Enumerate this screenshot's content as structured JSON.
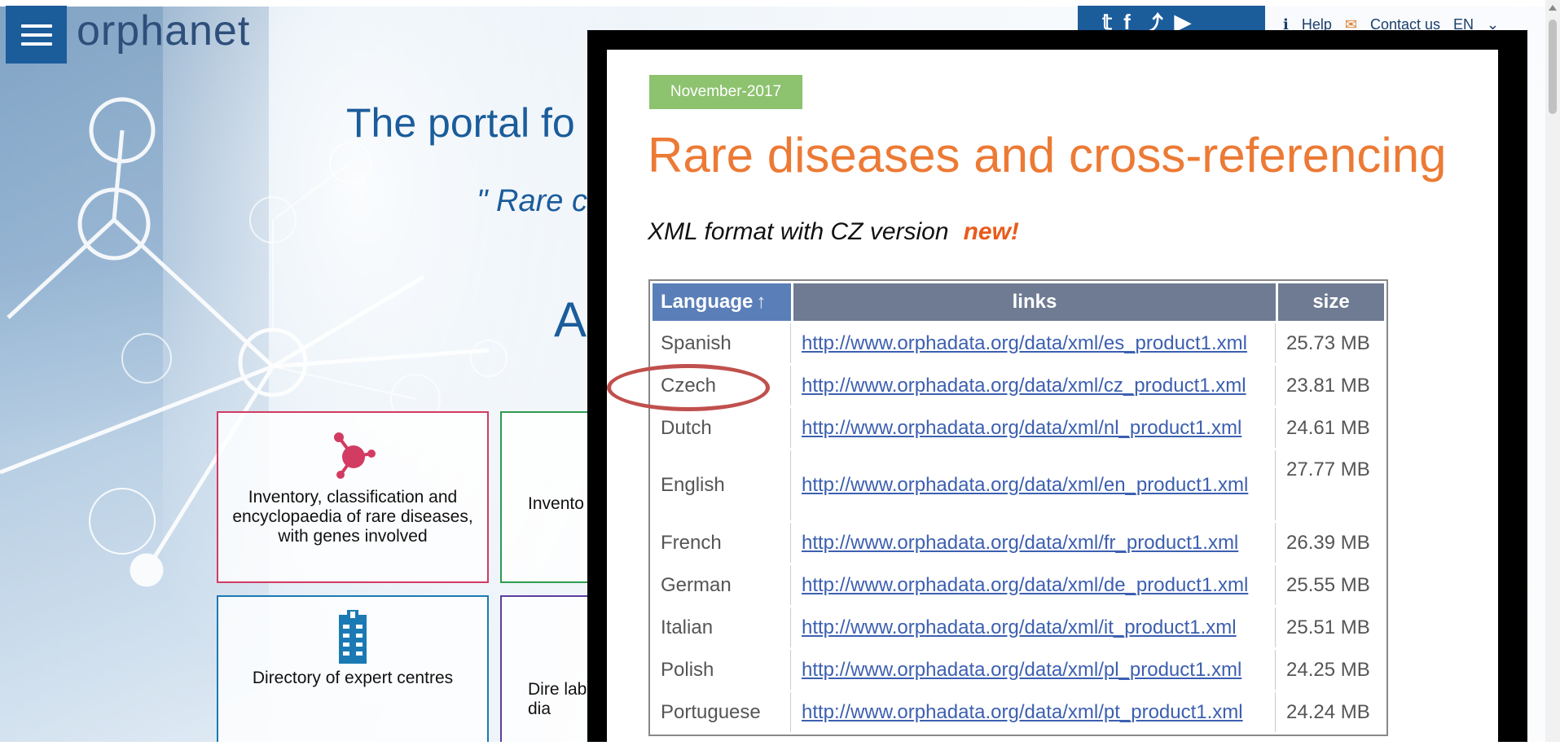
{
  "site": {
    "logo_text": "orphanet",
    "portal_title": "The portal fo",
    "portal_subtitle": "\" Rare c",
    "big_letter": "A",
    "help_label": "Help",
    "contact_label": "Contact us",
    "lang_label": "EN"
  },
  "cards": [
    {
      "text": "Inventory, classification and encyclopaedia of rare diseases, with genes involved",
      "color": "#d23b62"
    },
    {
      "text": "Invento",
      "color": "#2e9b4f"
    },
    {
      "text": "Directory of expert centres",
      "color": "#1b7ab3"
    },
    {
      "text": "Dire labo dia",
      "color": "#5b3f9c"
    }
  ],
  "overlay": {
    "date_badge": "November-2017",
    "title": "Rare diseases and cross-referencing",
    "xml_line": "XML format with CZ version",
    "new_label": "new!",
    "table": {
      "headers": {
        "language": "Language",
        "sort_arrow": "↑",
        "links": "links",
        "size": "size"
      },
      "rows": [
        {
          "language": "Spanish",
          "link": "http://www.orphadata.org/data/xml/es_product1.xml",
          "size": "25.73 MB"
        },
        {
          "language": "Czech",
          "link": "http://www.orphadata.org/data/xml/cz_product1.xml",
          "size": "23.81 MB"
        },
        {
          "language": "Dutch",
          "link": "http://www.orphadata.org/data/xml/nl_product1.xml",
          "size": "24.61 MB"
        },
        {
          "language": "English",
          "link": "http://www.orphadata.org/data/xml/en_product1.xml",
          "size": "27.77 MB"
        },
        {
          "language": "French",
          "link": "http://www.orphadata.org/data/xml/fr_product1.xml",
          "size": "26.39 MB"
        },
        {
          "language": "German",
          "link": "http://www.orphadata.org/data/xml/de_product1.xml",
          "size": "25.55 MB"
        },
        {
          "language": "Italian",
          "link": "http://www.orphadata.org/data/xml/it_product1.xml",
          "size": "25.51 MB"
        },
        {
          "language": "Polish",
          "link": "http://www.orphadata.org/data/xml/pl_product1.xml",
          "size": "24.25 MB"
        },
        {
          "language": "Portuguese",
          "link": "http://www.orphadata.org/data/xml/pt_product1.xml",
          "size": "24.24 MB"
        }
      ]
    }
  },
  "colors": {
    "brand_blue": "#1b5c9b",
    "title_orange": "#ec7a35",
    "badge_green": "#8dc26f",
    "highlight_red": "#c0504d"
  }
}
